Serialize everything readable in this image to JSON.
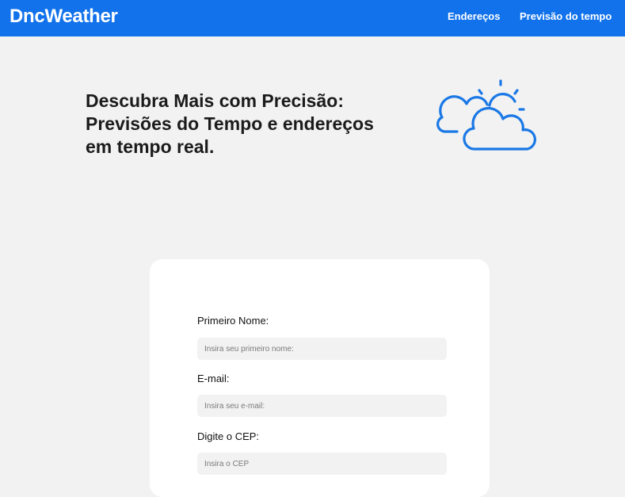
{
  "header": {
    "brand": "DncWeather",
    "nav": [
      "Endereços",
      "Previsão do tempo"
    ]
  },
  "hero": {
    "title_lines": [
      "Descubra Mais com Precisão:",
      "Previsões do Tempo e endereços",
      "em tempo real."
    ],
    "icon": "partly-cloudy-weather-icon"
  },
  "form": {
    "fields": [
      {
        "label": "Primeiro Nome:",
        "placeholder": "Insira seu primeiro nome:",
        "value": ""
      },
      {
        "label": "E-mail:",
        "placeholder": "Insira seu e-mail:",
        "value": ""
      },
      {
        "label": "Digite o CEP:",
        "placeholder": "Insira o CEP",
        "value": ""
      }
    ]
  },
  "colors": {
    "header_bg": "#1172eb",
    "icon_stroke": "#1a78e6",
    "page_bg": "#f2f2f2",
    "card_bg": "#ffffff"
  }
}
